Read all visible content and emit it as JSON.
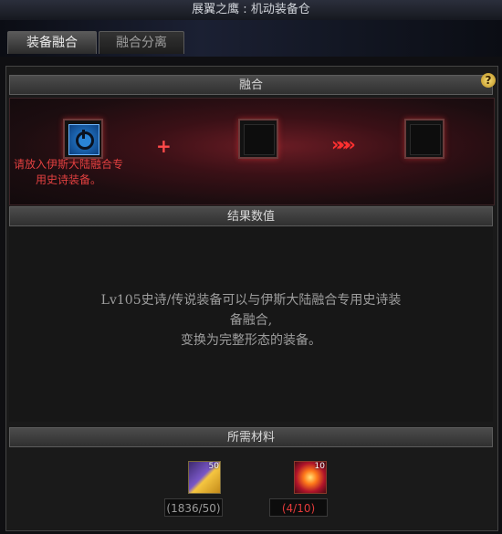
{
  "window": {
    "title": "展翼之鹰 : 机动装备仓"
  },
  "tabs": [
    {
      "label": "装备融合"
    },
    {
      "label": "融合分离"
    }
  ],
  "sections": {
    "fusion": "融合",
    "result": "结果数值",
    "materials": "所需材料"
  },
  "fusion": {
    "plus": "+",
    "arrows": "»»»",
    "warning_line1": "请放入伊斯大陆融合专",
    "warning_line2": "用史诗装备。"
  },
  "result": {
    "line1": "Lv105史诗/传说装备可以与伊斯大陆融合专用史诗装",
    "line2": "备融合,",
    "line3": "变换为完整形态的装备。"
  },
  "materials": [
    {
      "icon": "gold-box-icon",
      "badge": "50",
      "count": "(1836/50)"
    },
    {
      "icon": "fire-orb-icon",
      "badge": "10",
      "count": "(4/10)"
    }
  ],
  "help_icon": "?",
  "colors": {
    "warning": "#e14040",
    "shortage": "#e33a3a",
    "plus": "#ff4a4a"
  }
}
